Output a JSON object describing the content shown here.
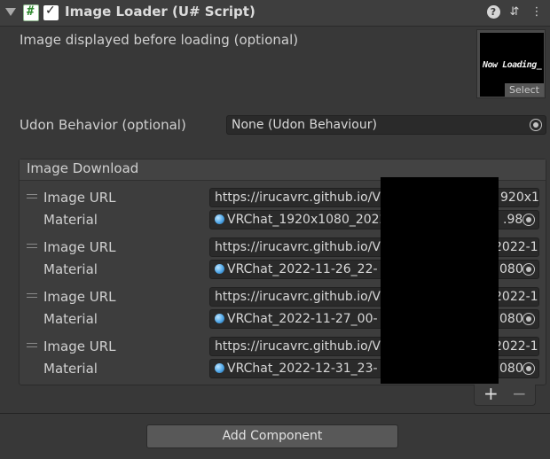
{
  "component": {
    "title": "Image Loader (U# Script)",
    "script_icon_glyph": "#",
    "enabled_glyph": "✓",
    "help_icon_glyph": "?",
    "settings_icon_glyph": "⇵",
    "menu_icon_glyph": "⋮"
  },
  "loading_image": {
    "label": "Image displayed before loading (optional)",
    "preview_text": "Now Loading_",
    "select_label": "Select"
  },
  "udon_behavior": {
    "label": "Udon Behavior (optional)",
    "value": "None (Udon Behaviour)"
  },
  "image_download": {
    "header": "Image Download",
    "entries": [
      {
        "url_label": "Image URL",
        "url_value": "https://irucavrc.github.io/VR",
        "url_tail": "920x1",
        "material_label": "Material",
        "material_value": "VRChat_1920x1080_2022",
        "material_tail": ".98"
      },
      {
        "url_label": "Image URL",
        "url_value": "https://irucavrc.github.io/VR",
        "url_tail": "2022-1",
        "material_label": "Material",
        "material_value": "VRChat_2022-11-26_22-",
        "material_tail": "080"
      },
      {
        "url_label": "Image URL",
        "url_value": "https://irucavrc.github.io/VR",
        "url_tail": "2022-1",
        "material_label": "Material",
        "material_value": "VRChat_2022-11-27_00-",
        "material_tail": "080"
      },
      {
        "url_label": "Image URL",
        "url_value": "https://irucavrc.github.io/VR",
        "url_tail": "2022-1",
        "material_label": "Material",
        "material_value": "VRChat_2022-12-31_23-",
        "material_tail": "080"
      }
    ],
    "add_glyph": "+",
    "remove_glyph": "−"
  },
  "add_component_label": "Add Component"
}
